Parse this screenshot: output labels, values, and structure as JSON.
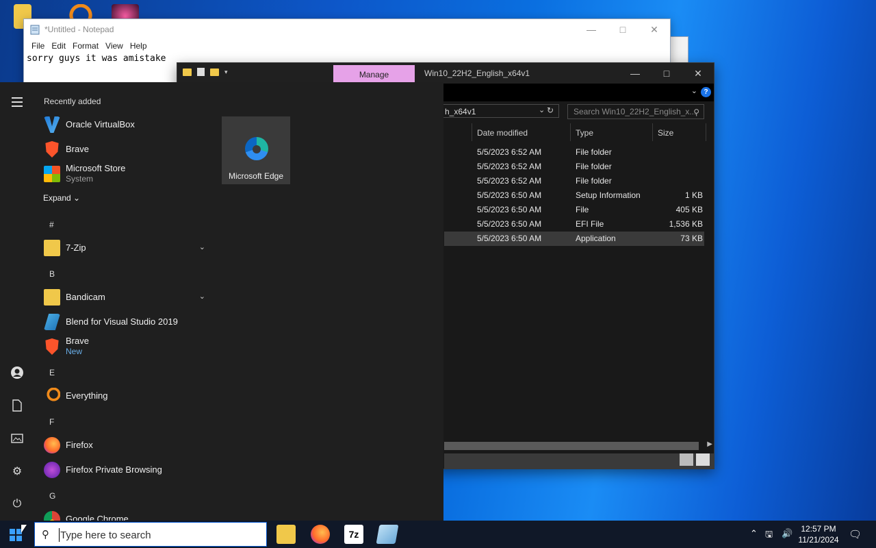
{
  "notepad": {
    "title": "*Untitled - Notepad",
    "menu": [
      "File",
      "Edit",
      "Format",
      "View",
      "Help"
    ],
    "content": "sorry guys it was amistake"
  },
  "explorer": {
    "manage_tab": "Manage",
    "title": "Win10_22H2_English_x64v1",
    "address_partial": "h_x64v1",
    "search_placeholder": "Search Win10_22H2_English_x...",
    "columns": [
      "Date modified",
      "Type",
      "Size"
    ],
    "rows": [
      {
        "date": "5/5/2023 6:52 AM",
        "type": "File folder",
        "size": ""
      },
      {
        "date": "5/5/2023 6:52 AM",
        "type": "File folder",
        "size": ""
      },
      {
        "date": "5/5/2023 6:52 AM",
        "type": "File folder",
        "size": ""
      },
      {
        "date": "5/5/2023 6:50 AM",
        "type": "Setup Information",
        "size": "1 KB"
      },
      {
        "date": "5/5/2023 6:50 AM",
        "type": "File",
        "size": "405 KB"
      },
      {
        "date": "5/5/2023 6:50 AM",
        "type": "EFI File",
        "size": "1,536 KB"
      },
      {
        "date": "5/5/2023 6:50 AM",
        "type": "Application",
        "size": "73 KB"
      }
    ]
  },
  "start_menu": {
    "recently_added_label": "Recently added",
    "recent": [
      {
        "name": "Oracle VirtualBox",
        "sub": "",
        "icon": "virtualbox-icon"
      },
      {
        "name": "Brave",
        "sub": "",
        "icon": "brave-icon"
      },
      {
        "name": "Microsoft Store",
        "sub": "System",
        "icon": "store-icon"
      }
    ],
    "expand_label": "Expand",
    "letters": [
      "#",
      "B",
      "E",
      "F",
      "G"
    ],
    "apps": [
      {
        "name": "7-Zip",
        "sub": ""
      },
      {
        "name": "Bandicam",
        "sub": ""
      },
      {
        "name": "Blend for Visual Studio 2019",
        "sub": ""
      },
      {
        "name": "Brave",
        "sub": "New"
      },
      {
        "name": "Everything",
        "sub": ""
      },
      {
        "name": "Firefox",
        "sub": ""
      },
      {
        "name": "Firefox Private Browsing",
        "sub": ""
      },
      {
        "name": "Google Chrome",
        "sub": ""
      }
    ],
    "pinned_tile": "Microsoft Edge"
  },
  "taskbar": {
    "search_placeholder": "Type here to search",
    "time": "12:57 PM",
    "date": "11/21/2024"
  },
  "colors": {
    "manage_tab": "#e6a2e8",
    "start_bg": "#1f1f1f",
    "accent": "#0a5cd6"
  }
}
